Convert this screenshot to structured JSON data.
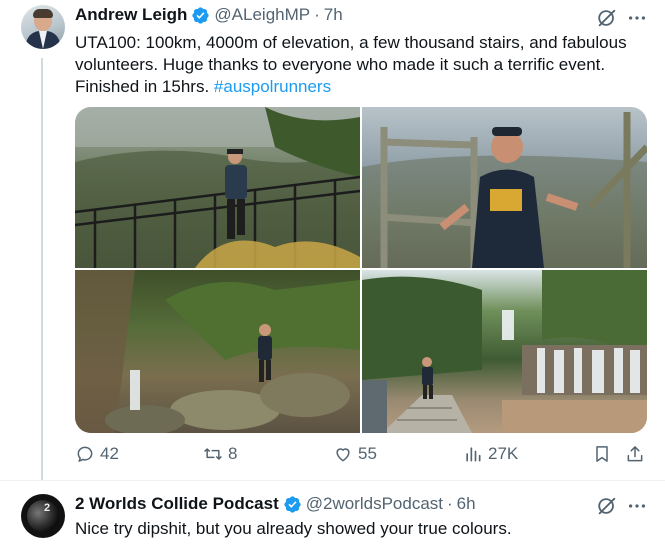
{
  "tweet": {
    "author_name": "Andrew Leigh",
    "handle": "@ALeighMP",
    "separator": "·",
    "time": "7h",
    "text_main": "UTA100: 100km, 4000m of elevation, a few thousand stairs, and fabulous volunteers. Huge thanks to everyone who made it such a terrific event. Finished in 15hrs. ",
    "hashtag": "#auspolrunners",
    "media_count": 4,
    "stats": {
      "replies": "42",
      "retweets": "8",
      "likes": "55",
      "views": "27K"
    }
  },
  "reply": {
    "author_name": "2 Worlds Collide Podcast",
    "handle": "@2worldsPodcast",
    "separator": "·",
    "time": "6h",
    "text": "Nice try dipshit, but you already showed your true colours.",
    "avatar_text": "2"
  },
  "colors": {
    "verified": "#1d9bf0",
    "hashtag": "#1d9bf0",
    "secondary_text": "#536471",
    "thread_line": "#cfd9de"
  },
  "icons": [
    "verified-badge-icon",
    "grok-icon",
    "more-icon",
    "reply-icon",
    "retweet-icon",
    "like-icon",
    "views-icon",
    "bookmark-icon",
    "share-icon"
  ]
}
